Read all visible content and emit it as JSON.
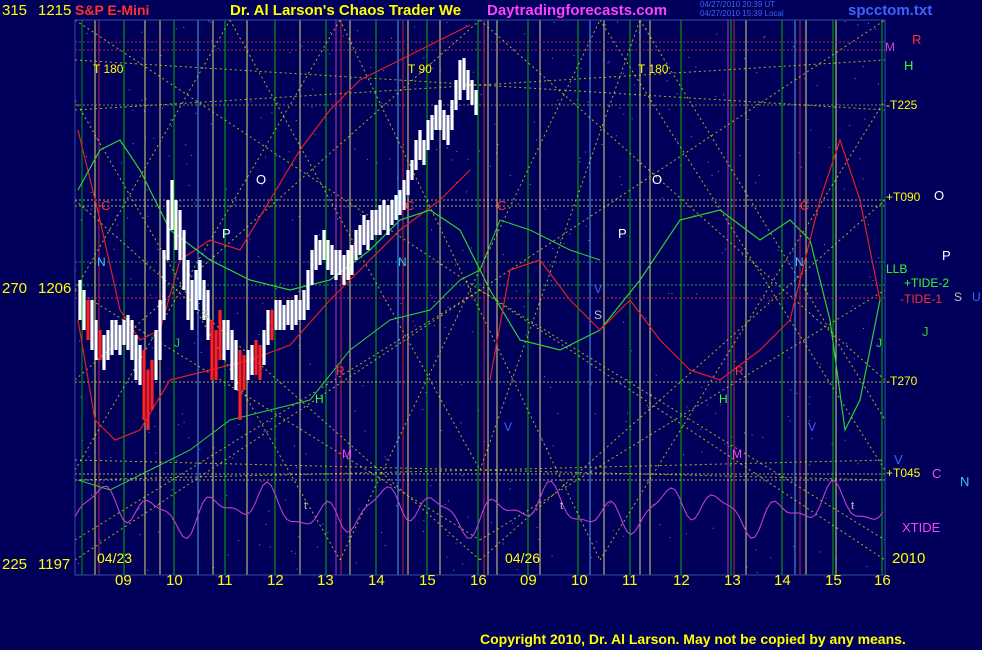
{
  "header": {
    "left_value": "315",
    "price_top": "1215",
    "instrument": "S&P E-Mini",
    "title": "Dr. Al Larson's Chaos Trader We",
    "site": "Daytradingforecasts.com",
    "time_ut": "04/27/2010 20:39 UT",
    "time_local": "04/27/2010 15:39 Local",
    "file": "spcctom.txt"
  },
  "axis": {
    "mid_left": "270",
    "price_mid": "1206",
    "bottom_left": "225",
    "price_bottom": "1197",
    "date_left": "04/23",
    "date_mid": "04/26",
    "year": "2010",
    "hour_labels": [
      "09",
      "10",
      "11",
      "12",
      "13",
      "14",
      "15",
      "16",
      "09",
      "10",
      "11",
      "12",
      "13",
      "14",
      "15",
      "16"
    ]
  },
  "right_labels": {
    "M": "M",
    "R": "R",
    "H": "H",
    "T225": "-T225",
    "T090": "+T090",
    "O": "O",
    "LLB": "LLB",
    "P": "P",
    "TIDE2": "+TIDE-2",
    "TIDE1": "-TIDE-1",
    "S": "S",
    "U": "U",
    "J": "J",
    "T270": "-T270",
    "V": "V",
    "T045": "+T045",
    "C": "C",
    "N": "N",
    "XTIDE": "XTIDE"
  },
  "chart_labels": {
    "T180a": "T  180",
    "T90": "T  90",
    "T180b": "T  180",
    "O1": "O",
    "O2": "O",
    "P1": "P",
    "P2": "P",
    "C1": "C",
    "C2": "C",
    "C3": "C",
    "C4": "C",
    "N1": "N",
    "N2": "N",
    "N3": "N",
    "J1": "J",
    "J2": "J",
    "R1": "R",
    "R2": "R",
    "H1": "H",
    "H2": "H",
    "M1": "M",
    "M2": "M",
    "V1": "V",
    "V2": "V",
    "V3": "V",
    "S1": "S",
    "S2": "S",
    "t1": "t",
    "t2": "t",
    "t3": "t"
  },
  "footer": {
    "copyright": "Copyright 2010, Dr. Al Larson. May not be copied by any means."
  },
  "colors": {
    "background": "#00005a",
    "grid_dotted": "#e8e800",
    "green_vertical": "#00b400",
    "cyan_vertical": "#60c0ff",
    "magenta_vertical": "#d040d0",
    "red_vertical": "#e03030",
    "red_curve": "#e02020",
    "green_curve": "#30d030",
    "xtide": "#c040c0",
    "bar_white": "#ffffff",
    "bar_red": "#ff2020"
  },
  "chart_data": {
    "type": "line",
    "title": "S&P E-Mini",
    "xlabel": "",
    "ylabel": "",
    "ylim": [
      1197,
      1215
    ],
    "x_ticks": [
      "04/23 09",
      "10",
      "11",
      "12",
      "13",
      "14",
      "15",
      "16",
      "04/26 09",
      "10",
      "11",
      "12",
      "13",
      "14",
      "15",
      "16"
    ],
    "price_levels": [
      1197,
      1206,
      1215
    ],
    "price_path_approx": [
      {
        "x": "04/23 09:00",
        "y": 1206
      },
      {
        "x": "04/23 09:30",
        "y": 1203.5
      },
      {
        "x": "04/23 09:50",
        "y": 1201
      },
      {
        "x": "04/23 10:00",
        "y": 1209.5
      },
      {
        "x": "04/23 10:30",
        "y": 1206
      },
      {
        "x": "04/23 11:00",
        "y": 1202
      },
      {
        "x": "04/23 11:30",
        "y": 1203
      },
      {
        "x": "04/23 12:00",
        "y": 1204.5
      },
      {
        "x": "04/23 12:30",
        "y": 1205
      },
      {
        "x": "04/23 13:00",
        "y": 1207.5
      },
      {
        "x": "04/23 13:30",
        "y": 1207
      },
      {
        "x": "04/23 14:00",
        "y": 1208.5
      },
      {
        "x": "04/23 14:30",
        "y": 1209.5
      },
      {
        "x": "04/23 15:00",
        "y": 1211.5
      },
      {
        "x": "04/23 15:30",
        "y": 1213.5
      },
      {
        "x": "04/23 15:50",
        "y": 1213
      }
    ]
  }
}
